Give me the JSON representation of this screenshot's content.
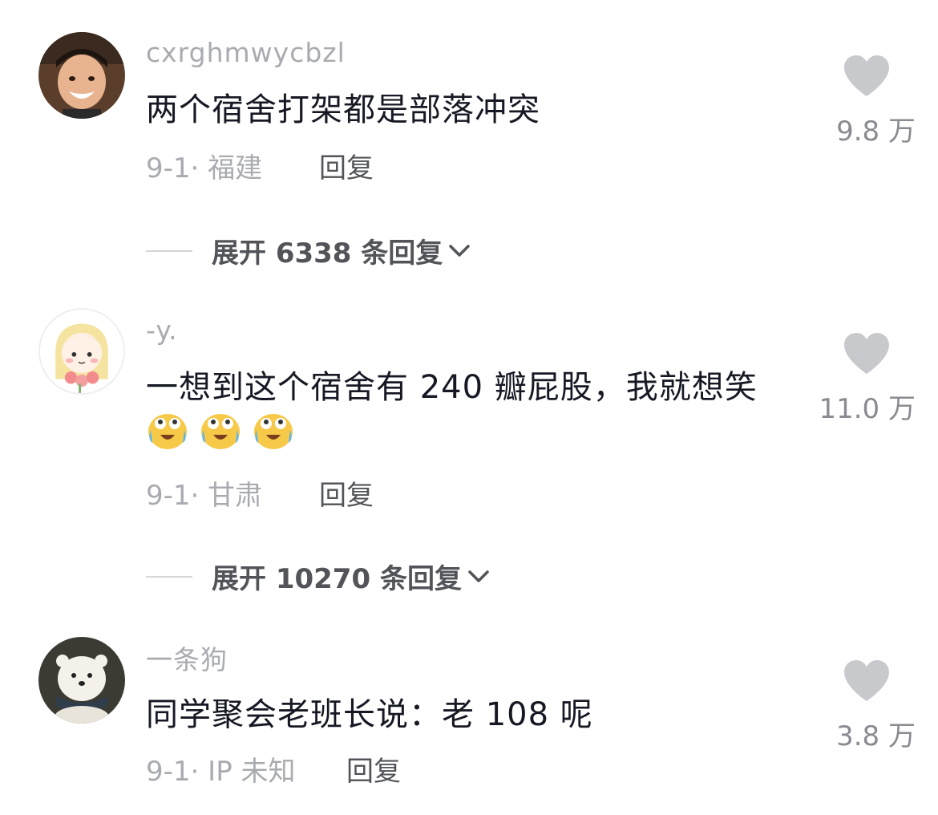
{
  "comments": [
    {
      "username": "cxrghmwycbzl",
      "text": "两个宿舍打架都是部落冲突",
      "date": "9-1",
      "location": "· 福建",
      "reply_label": "回复",
      "likes": "9.8 万",
      "expand_label": "展开 6338 条回复",
      "avatar": "photo-boy-smiling"
    },
    {
      "username": "-y.",
      "text": "一想到这个宿舍有 240 瓣屁股，我就想笑",
      "emojis": [
        "laughing-crying-emoji",
        "laughing-crying-emoji",
        "laughing-crying-emoji"
      ],
      "date": "9-1",
      "location": "· 甘肃",
      "reply_label": "回复",
      "likes": "11.0 万",
      "expand_label": "展开 10270 条回复",
      "avatar": "cartoon-girl-with-flowers"
    },
    {
      "username": "一条狗",
      "text": "同学聚会老班长说：老 108 呢",
      "date": "9-1",
      "location": "· IP 未知",
      "reply_label": "回复",
      "likes": "3.8 万",
      "avatar": "white-bear-with-scarf"
    }
  ],
  "colors": {
    "text_primary": "#161823",
    "text_secondary": "#a9abb0",
    "reply_text": "#525459",
    "heart": "#c8c9cc"
  },
  "icons": {
    "like": "heart-icon",
    "expand": "chevron-down-icon"
  }
}
